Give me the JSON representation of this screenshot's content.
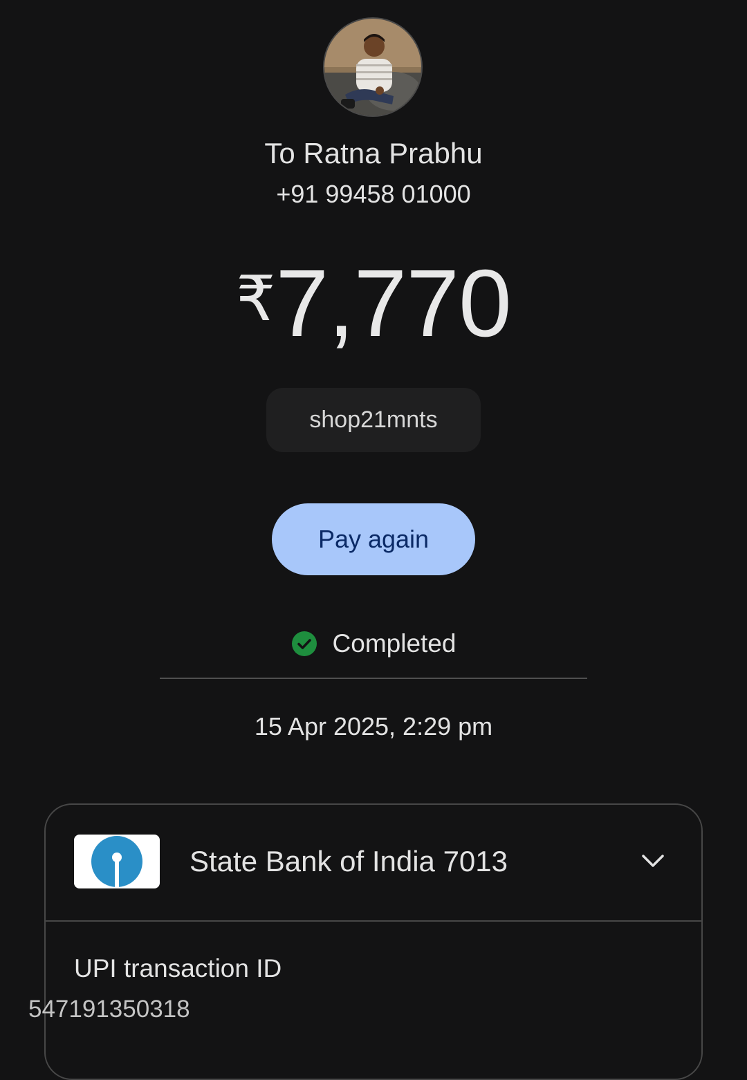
{
  "recipient": {
    "avatar_icon": "person-photo",
    "name": "To Ratna Prabhu",
    "phone": "+91 99458 01000"
  },
  "amount": {
    "currency_symbol": "₹",
    "value": "7,770"
  },
  "note": "shop21mnts",
  "actions": {
    "pay_again_label": "Pay again"
  },
  "status": {
    "icon": "check-circle-icon",
    "text": "Completed",
    "color": "#1e8e3e"
  },
  "datetime": "15 Apr 2025, 2:29 pm",
  "details": {
    "bank_name": "State Bank of India 7013",
    "bank_logo_icon": "sbi-logo",
    "bank_logo_color": "#2a8fc7",
    "expand_icon": "chevron-down-icon",
    "upi_label": "UPI transaction ID",
    "upi_id": "547191350318"
  },
  "colors": {
    "background": "#131314",
    "button_bg": "#a8c7fa",
    "button_text": "#0b2a66"
  }
}
